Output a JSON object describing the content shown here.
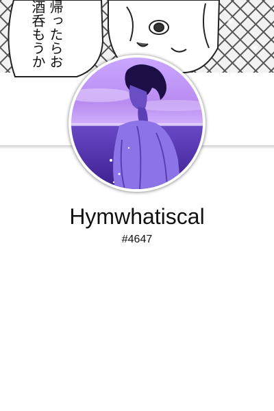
{
  "banner": {
    "speech_text": "帰ったらお酒呑もうか"
  },
  "profile": {
    "username": "Hymwhatiscal",
    "discriminator": "#4647"
  },
  "colors": {
    "background": "#ffffff",
    "text": "#111111",
    "avatar_purple": "#7a4fd6"
  }
}
